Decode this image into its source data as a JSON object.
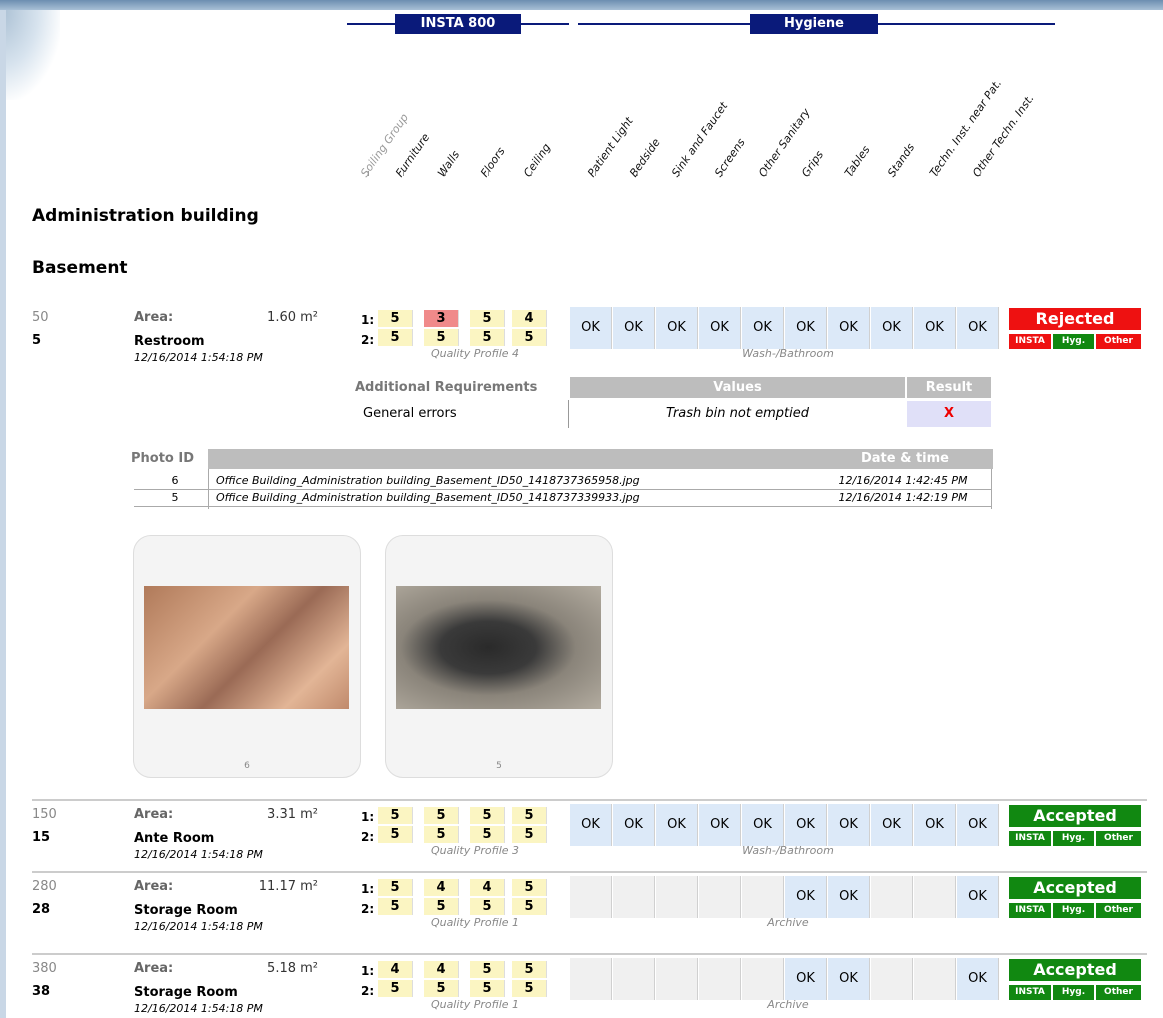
{
  "groups": {
    "insta": "INSTA 800",
    "hygiene": "Hygiene"
  },
  "columns": [
    "Soiling Group",
    "Furniture",
    "Walls",
    "Floors",
    "Ceiling",
    "Patient Light",
    "Bedside",
    "Sink and Faucet",
    "Screens",
    "Other Sanitary",
    "Grips",
    "Tables",
    "Stands",
    "Techn. Inst. near Pat.",
    "Other Techn. Inst."
  ],
  "building": "Administration building",
  "floor": "Basement",
  "labels": {
    "area": "Area:",
    "row1": "1:",
    "row2": "2:",
    "additional_requirements": "Additional Requirements",
    "values": "Values",
    "result": "Result",
    "photo_id": "Photo ID",
    "date_time": "Date & time"
  },
  "rooms": [
    {
      "n1": "50",
      "n2": "5",
      "area": "1.60 m²",
      "name": "Restroom",
      "date": "12/16/2014 1:54:18 PM",
      "q1": [
        "5",
        "3",
        "5",
        "4"
      ],
      "q2": [
        "5",
        "5",
        "5",
        "5"
      ],
      "quality_profile": "Quality Profile 4",
      "hyg": [
        "OK",
        "OK",
        "OK",
        "OK",
        "OK",
        "OK",
        "OK",
        "OK",
        "OK",
        "OK"
      ],
      "hyg_profile": "Wash-/Bathroom",
      "status": "Rejected",
      "status_color": "#ee1111",
      "mini": [
        "INSTA",
        "Hyg.",
        "Other"
      ],
      "requirement": {
        "label": "General errors",
        "value": "Trash bin not emptied",
        "result": "X"
      },
      "photos": [
        {
          "id": "6",
          "file": "Office Building_Administration building_Basement_ID50_1418737365958.jpg",
          "date": "12/16/2014 1:42:45 PM"
        },
        {
          "id": "5",
          "file": "Office Building_Administration building_Basement_ID50_1418737339933.jpg",
          "date": "12/16/2014 1:42:19 PM"
        }
      ]
    },
    {
      "n1": "150",
      "n2": "15",
      "area": "3.31 m²",
      "name": "Ante Room",
      "date": "12/16/2014 1:54:18 PM",
      "q1": [
        "5",
        "5",
        "5",
        "5"
      ],
      "q2": [
        "5",
        "5",
        "5",
        "5"
      ],
      "quality_profile": "Quality Profile 3",
      "hyg": [
        "OK",
        "OK",
        "OK",
        "OK",
        "OK",
        "OK",
        "OK",
        "OK",
        "OK",
        "OK"
      ],
      "hyg_profile": "Wash-/Bathroom",
      "status": "Accepted",
      "status_color": "#118811",
      "mini": [
        "INSTA",
        "Hyg.",
        "Other"
      ]
    },
    {
      "n1": "280",
      "n2": "28",
      "area": "11.17 m²",
      "name": "Storage Room",
      "date": "12/16/2014 1:54:18 PM",
      "q1": [
        "5",
        "4",
        "4",
        "5"
      ],
      "q2": [
        "5",
        "5",
        "5",
        "5"
      ],
      "quality_profile": "Quality Profile 1",
      "hyg": [
        "",
        "",
        "",
        "",
        "",
        "OK",
        "OK",
        "",
        "",
        "OK"
      ],
      "hyg_profile": "Archive",
      "status": "Accepted",
      "status_color": "#118811",
      "mini": [
        "INSTA",
        "Hyg.",
        "Other"
      ]
    },
    {
      "n1": "380",
      "n2": "38",
      "area": "5.18 m²",
      "name": "Storage Room",
      "date": "12/16/2014 1:54:18 PM",
      "q1": [
        "4",
        "4",
        "5",
        "5"
      ],
      "q2": [
        "5",
        "5",
        "5",
        "5"
      ],
      "quality_profile": "Quality Profile 1",
      "hyg": [
        "",
        "",
        "",
        "",
        "",
        "OK",
        "OK",
        "",
        "",
        "OK"
      ],
      "hyg_profile": "Archive",
      "status": "Accepted",
      "status_color": "#118811",
      "mini": [
        "INSTA",
        "Hyg.",
        "Other"
      ]
    }
  ]
}
